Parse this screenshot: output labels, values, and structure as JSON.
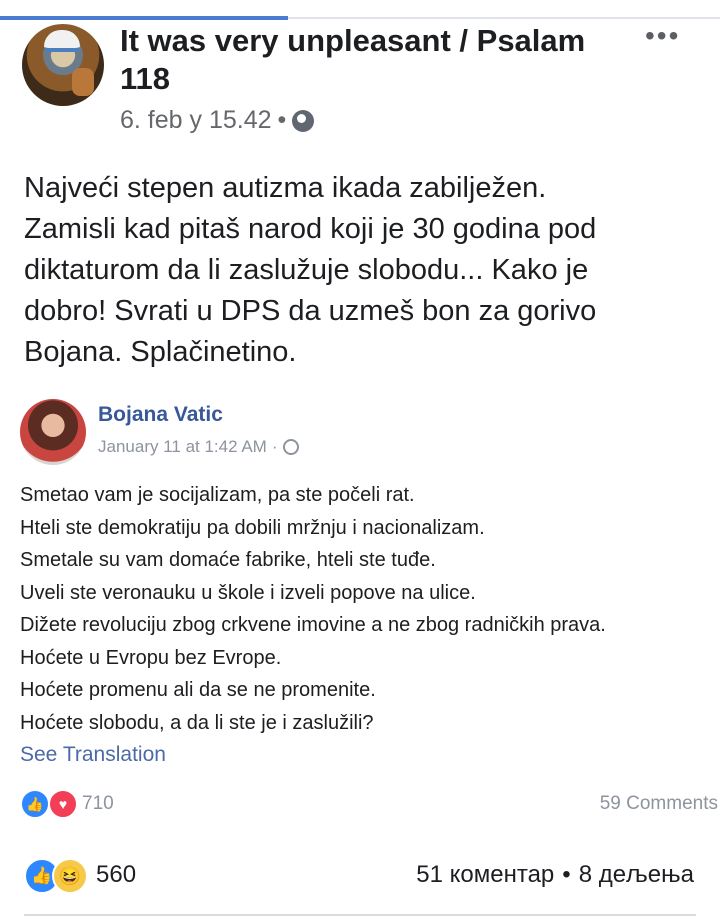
{
  "post": {
    "author_title_line1": "It was very unpleasant / Psalam",
    "author_title_line2": "118",
    "timestamp": "6. feb у 15.42",
    "meta_separator": "•",
    "more_icon": "•••",
    "text_lines": [
      "Najveći stepen autizma ikada zabilježen.",
      "Zamisli kad pitaš narod koji je 30 godina pod",
      "diktaturom da li zaslužuje slobodu... Kako je",
      "dobro! Svrati u DPS da uzmeš bon za gorivo",
      "Bojana. Splačinetino."
    ]
  },
  "shared": {
    "author": "Bojana Vatic",
    "timestamp": "January 11 at 1:42 AM",
    "meta_separator": "·",
    "lines": [
      "Smetao vam je socijalizam, pa ste počeli rat.",
      "Hteli ste demokratiju pa dobili mržnju i nacionalizam.",
      "Smetale su vam domaće fabrike, hteli ste tuđe.",
      "Uveli ste veronauku u škole i izveli popove na ulice.",
      "Dižete revoluciju zbog crkvene imovine a ne zbog radničkih prava.",
      "Hoćete u Evropu bez Evrope.",
      "Hoćete promenu ali da se ne promenite.",
      "Hoćete slobodu, a da li ste je i zaslužili?"
    ],
    "see_translation": "See Translation",
    "reaction_count": "710",
    "comments": "59 Comments"
  },
  "footer": {
    "reaction_count": "560",
    "comments": "51 коментар",
    "separator": "•",
    "shares": "8 дељења"
  },
  "colors": {
    "link_blue": "#385898",
    "like_blue": "#2d88ff",
    "love_red": "#f33e58",
    "haha_yellow": "#f7c948",
    "progress_blue": "#4a7bd0"
  }
}
